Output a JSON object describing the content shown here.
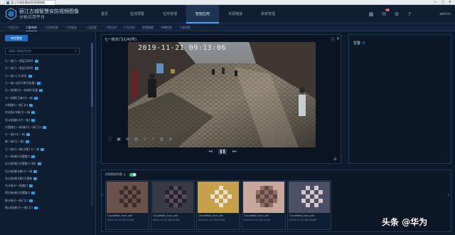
{
  "browser": {
    "tab_title": "丽江古城智慧安防视频图像...",
    "controls": "— ▢ ✕"
  },
  "brand": {
    "line1": "丽江古城智慧安防视频图像",
    "line2": "分析应用平台"
  },
  "topnav": [
    "首页",
    "监测预警",
    "任务管理",
    "智能应用",
    "资源链接",
    "系统管理"
  ],
  "topnav_active": "智能应用",
  "notification_count": "12",
  "user": "admin",
  "subnav": [
    "人员比对",
    "人脸布控",
    "人员库检索",
    "人员轨迹",
    "人员档案",
    "人脸比对",
    "行为分析",
    "视频摘要",
    "车辆检索",
    "人体检索"
  ],
  "subnav_active": "人脸布控",
  "sidebar": {
    "button": "布控管理",
    "search_placeholder": "请输入摄像机名称",
    "items": [
      "七一街六一多层108号",
      "七一街六一多层109号",
      "七一街八门口4号",
      "七一街八街(108号花楼)",
      "七一街(新)七一街(新)花楼",
      "七一街散门(新)七一街",
      "大理路七一街门口",
      "文化街口(新)七一街",
      "光义街路口(七一街)",
      "大理路七一街(新)七一街门口",
      "七一街口七一街",
      "新一街(七一街)",
      "七一街七一街口(新) 七一街",
      "七一街(新)大理路口",
      "光义街(新)大理路口 (新)",
      "光义街(新)(新)七一街",
      "光义街(新)(新)大理路",
      "光义街七一街路口",
      "四方街(新)大理路口",
      "新义街七一街门口",
      "新义街(新)七一街门口"
    ]
  },
  "video": {
    "title": "七一街天门(1/43号)",
    "timestamp": "2019-11-21  09:13:06"
  },
  "alarm": {
    "title": "告警",
    "count": "0"
  },
  "results": {
    "title": "识别抓拍列表",
    "count": "8",
    "cards": [
      {
        "label": "CloudWalk_face_sdk",
        "time": "2019-11-21 09:13:00"
      },
      {
        "label": "CloudWalk_face_sdk",
        "time": "2019-11-21 09:13:03"
      },
      {
        "label": "CloudWalk_face_sdk",
        "time": "2019-11-21 09:12:54"
      },
      {
        "label": "CloudWalk_face_sdk",
        "time": "2019-11-21 09:13:01"
      },
      {
        "label": "CloudWalk_face_sdk",
        "time": "2019-11-21 09:13:08"
      }
    ]
  },
  "watermark": "头条 @华为",
  "colors": {
    "accent": "#3fa9f5",
    "toggle_on": "#23c46b",
    "background": "#0d1a2b"
  }
}
